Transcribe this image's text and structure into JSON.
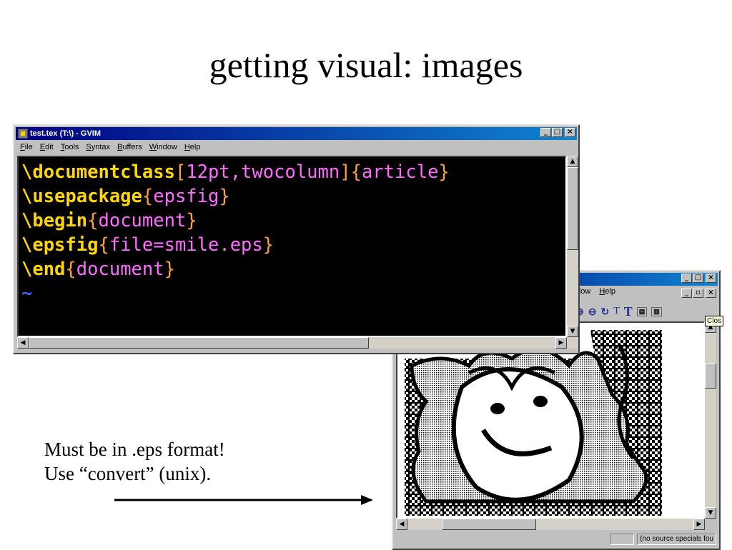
{
  "slide": {
    "title": "getting visual: images",
    "notes": [
      "Must be in .eps format!",
      "Use “convert” (unix)."
    ]
  },
  "gvim": {
    "title": "test.tex (T:\\) - GVIM",
    "menu": [
      "File",
      "Edit",
      "Tools",
      "Syntax",
      "Buffers",
      "Window",
      "Help"
    ],
    "code": [
      {
        "cmd": "\\documentclass",
        "opt_open": "[",
        "opt": "12pt,twocolumn",
        "opt_close": "]",
        "arg_open": "{",
        "arg": "article",
        "arg_close": "}"
      },
      {
        "cmd": "\\usepackage",
        "arg_open": "{",
        "arg": "epsfig",
        "arg_close": "}"
      },
      {
        "cmd": "\\begin",
        "arg_open": "{",
        "arg": "document",
        "arg_close": "}"
      },
      {
        "cmd": "\\epsfig",
        "arg_open": "{",
        "arg": "file=smile.eps",
        "arg_close": "}"
      },
      {
        "cmd": "\\end",
        "arg_open": "{",
        "arg": "document",
        "arg_close": "}"
      }
    ],
    "empty_line_marker": "~"
  },
  "viewer": {
    "menu": [
      "ndow",
      "Help"
    ],
    "toolbar_icons": [
      "zoom-in-icon",
      "zoom-out-icon",
      "redisplay-icon",
      "text-small-icon",
      "text-large-icon",
      "page-icon",
      "two-page-icon"
    ],
    "toolbar_text": [
      "T",
      "T"
    ],
    "tooltip": "Clos",
    "status": "(no source specials fou"
  },
  "colors": {
    "command": "#ffd700",
    "argument": "#ff6aff",
    "bracket": "#ffa040",
    "editor_bg": "#000000",
    "title_bar": "#000080"
  }
}
